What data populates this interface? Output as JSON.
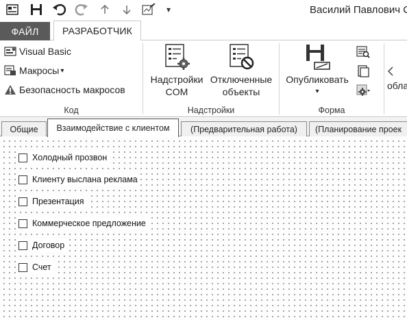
{
  "qat": {
    "user_name": "Василий Павлович С",
    "more_glyph": "▾"
  },
  "ribbon_tabs": {
    "file": "ФАЙЛ",
    "developer": "РАЗРАБОТЧИК"
  },
  "groups": {
    "code": {
      "label": "Код",
      "items": {
        "visual_basic": "Visual Basic",
        "macros": "Макросы",
        "macros_arrow": "▾",
        "macro_security": "Безопасность макросов"
      }
    },
    "addins": {
      "label": "Надстройки",
      "com_addins": {
        "line1": "Надстройки",
        "line2": "COM"
      },
      "disabled_items": {
        "line1": "Отключенные",
        "line2": "объекты"
      }
    },
    "form": {
      "label": "Форма",
      "publish": "Опубликовать",
      "publish_arrow": "▾"
    },
    "clipped": {
      "label": "обла"
    }
  },
  "form_tabs": [
    {
      "label": "Общие"
    },
    {
      "label": "Взаимодействие с клиентом"
    },
    {
      "label": "(Предварительная работа)"
    },
    {
      "label": "(Планирование проек"
    }
  ],
  "checkboxes": [
    {
      "label": "Холодный прозвон",
      "checked": false
    },
    {
      "label": "Клиенту выслана реклама",
      "checked": false
    },
    {
      "label": "Презентация",
      "checked": false
    },
    {
      "label": "Коммерческое предложение",
      "checked": false
    },
    {
      "label": "Договор",
      "checked": false
    },
    {
      "label": "Счет",
      "checked": false
    }
  ],
  "icons": {
    "qat": [
      "form-icon",
      "save-icon",
      "undo-icon",
      "redo-icon",
      "arrow-up-icon",
      "arrow-down-icon",
      "design-form-icon",
      "customize-qat-icon"
    ],
    "code": [
      "visual-basic-icon",
      "macros-icon",
      "warning-icon"
    ],
    "addins": [
      "com-addins-icon",
      "disabled-items-icon"
    ],
    "form": [
      "publish-icon",
      "field-chooser-icon",
      "view-code-icon",
      "properties-icon"
    ]
  }
}
